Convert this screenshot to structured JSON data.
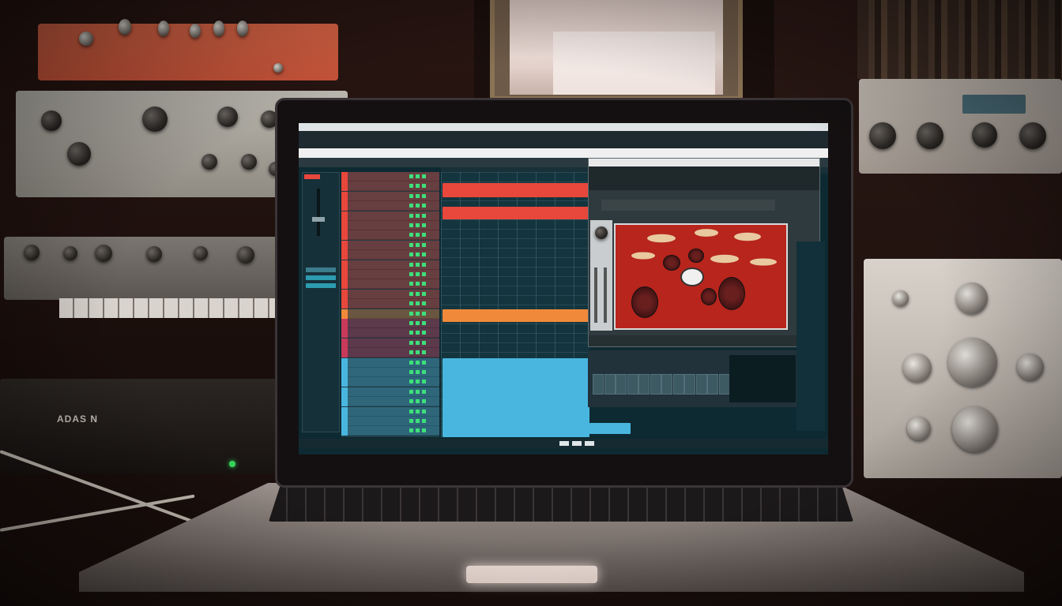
{
  "scene": {
    "description_free": true
  },
  "gear": {
    "black_unit_label": "ADAS N"
  },
  "daw": {
    "tracks": [
      {
        "color": "#e8473c"
      },
      {
        "color": "#e8473c"
      },
      {
        "color": "#e8473c"
      },
      {
        "color": "#e8473c"
      },
      {
        "color": "#e8473c"
      },
      {
        "color": "#e8473c"
      },
      {
        "color": "#e8473c"
      },
      {
        "color": "#e8473c"
      },
      {
        "color": "#e8473c"
      },
      {
        "color": "#e8473c"
      },
      {
        "color": "#e8473c"
      },
      {
        "color": "#e8473c"
      },
      {
        "color": "#e8473c"
      },
      {
        "color": "#e8473c"
      },
      {
        "color": "#f08a3a"
      },
      {
        "color": "#c93a5a"
      },
      {
        "color": "#c93a5a"
      },
      {
        "color": "#c93a5a"
      },
      {
        "color": "#c93a5a"
      },
      {
        "color": "#49b6e0"
      },
      {
        "color": "#49b6e0"
      },
      {
        "color": "#49b6e0"
      },
      {
        "color": "#49b6e0"
      },
      {
        "color": "#49b6e0"
      },
      {
        "color": "#49b6e0"
      },
      {
        "color": "#49b6e0"
      },
      {
        "color": "#49b6e0"
      }
    ],
    "colors": {
      "drums": "#e8473c",
      "orange": "#f08a3a",
      "bass": "#c93a5a",
      "keys": "#49b6e0"
    }
  }
}
